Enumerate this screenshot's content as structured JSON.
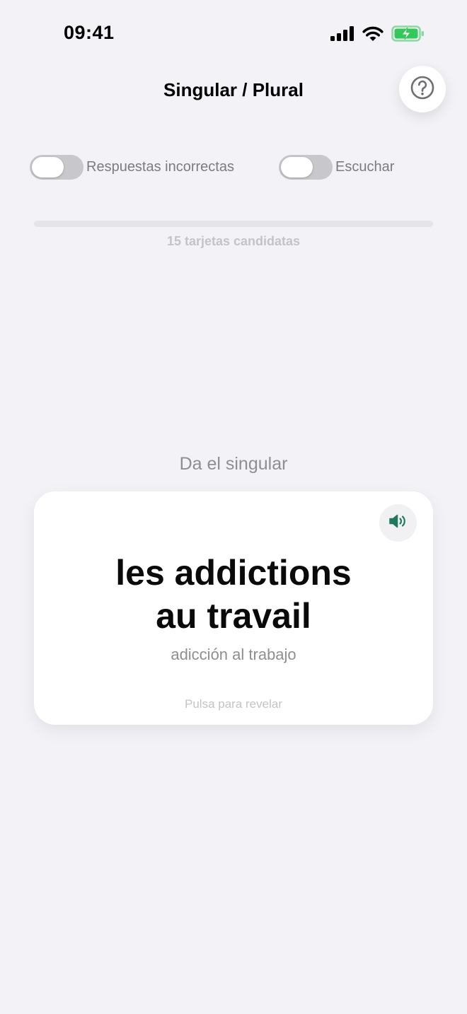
{
  "status_bar": {
    "time": "09:41",
    "icons": [
      "cellular-signal-icon",
      "wifi-icon",
      "battery-charging-icon"
    ],
    "battery_color": "#34c759"
  },
  "header": {
    "title": "Singular / Plural",
    "help_icon": "question-mark-icon"
  },
  "toggles": [
    {
      "label": "Respuestas incorrectas",
      "on": false
    },
    {
      "label": "Escuchar",
      "on": false
    }
  ],
  "progress": {
    "fraction": 0,
    "label": "15 tarjetas candidatas"
  },
  "prompt": "Da el singular",
  "card": {
    "word_line1": "les addictions",
    "word_line2": "au travail",
    "translation": "adicción al trabajo",
    "reveal_hint": "Pulsa para revelar",
    "sound_icon": "speaker-icon",
    "accent_color": "#1f7a5c"
  }
}
